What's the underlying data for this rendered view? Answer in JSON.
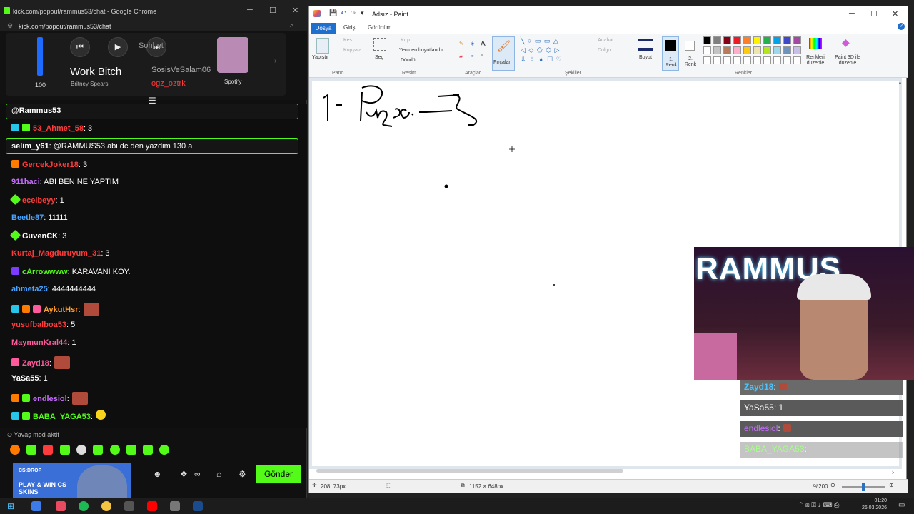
{
  "chrome": {
    "window_title": "kick.com/popout/rammus53/chat - Google Chrome",
    "url": "kick.com/popout/rammus53/chat"
  },
  "media": {
    "volume": "100",
    "track_title": "Work Bitch",
    "artist": "Britney Spears",
    "app": "Spotify",
    "overlay_user1": "SosisVeSalam06",
    "overlay_user2": "ogz_oztrk",
    "overlay_label": "Sohbet"
  },
  "chat": {
    "messages": [
      {
        "user": "@Rammus53",
        "text": "",
        "color": "#ffffff"
      },
      {
        "user": "53_Ahmet_58",
        "text": ": 3",
        "color": "#ff3b3b"
      },
      {
        "user": "selim_y61",
        "text": ": @RAMMUS53 abi dc den yazdim 130 a",
        "color": "#ffffff"
      },
      {
        "user": "GercekJoker18",
        "text": ": 3",
        "color": "#ff3b3b"
      },
      {
        "user": "911haci",
        "text": ": ABI BEN NE YAPTIM",
        "color": "#c86cff"
      },
      {
        "user": "ecelbeyy",
        "text": ": 1",
        "color": "#ff3b3b"
      },
      {
        "user": "Beetle87",
        "text": ": 11111",
        "color": "#4aa3ff"
      },
      {
        "user": "GuvenCK",
        "text": ": 3",
        "color": "#ffffff"
      },
      {
        "user": "Kurtaj_Magduruyum_31",
        "text": ": 3",
        "color": "#ff3b3b"
      },
      {
        "user": "cArrowwww",
        "text": ": KARAVANI KOY.",
        "color": "#53fc18"
      },
      {
        "user": "ahmeta25",
        "text": ": 4444444444",
        "color": "#4aa3ff"
      },
      {
        "user": "AykutHsr",
        "text": ":",
        "color": "#ff9f2e"
      },
      {
        "user": "yusufbalboa53",
        "text": ": 5",
        "color": "#ff3b3b"
      },
      {
        "user": "MaymunKral44",
        "text": ": 1",
        "color": "#ff5a9e"
      },
      {
        "user": "Zayd18",
        "text": ":",
        "color": "#ff5a9e"
      },
      {
        "user": "YaSa55",
        "text": ": 1",
        "color": "#ffffff"
      },
      {
        "user": "endlesiol",
        "text": ":",
        "color": "#c86cff"
      },
      {
        "user": "BABA_YAGA53",
        "text": ":",
        "color": "#53fc18"
      }
    ],
    "slow_mode": "Yavaş mod aktif",
    "send_label": "Gönder",
    "promo": "PLAY & WIN CS SKINS",
    "promo_brand": "CS:DROP"
  },
  "paint": {
    "title": "Adsız - Paint",
    "tabs": [
      "Dosya",
      "Giriş",
      "Görünüm"
    ],
    "pano_paste": "Yapıştır",
    "pano_cut": "Kes",
    "pano_copy": "Kopyala",
    "resim_select": "Seç",
    "resim_crop": "Kırp",
    "resim_resize": "Yeniden boyutlandır",
    "resim_rotate": "Döndür",
    "brushes": "Fırçalar",
    "outline": "Anahat",
    "fill": "Dolgu",
    "size": "Boyut",
    "color1": "1. Renk",
    "color2": "2. Renk",
    "edit_colors": "Renkleri düzenle",
    "paint3d": "Paint 3D ile düzenle",
    "groups": [
      "Pano",
      "Resim",
      "Araçlar",
      "Şekiller",
      "Renkler"
    ],
    "cursor_pos": "208, 73px",
    "canvas_size": "1152 × 648px",
    "zoom": "%200",
    "canvas_text": "1-Pügci - Z"
  },
  "overlay": [
    {
      "user": "Zayd18",
      "text": ":"
    },
    {
      "user": "YaSa55",
      "text": ": 1"
    },
    {
      "user": "endlesiol",
      "text": ":"
    },
    {
      "user": "BABA_YAGA53",
      "text": ":"
    }
  ],
  "cam_text": "RAMMUS",
  "taskbar": {
    "time": "01:20",
    "date": "26.03.2026"
  }
}
